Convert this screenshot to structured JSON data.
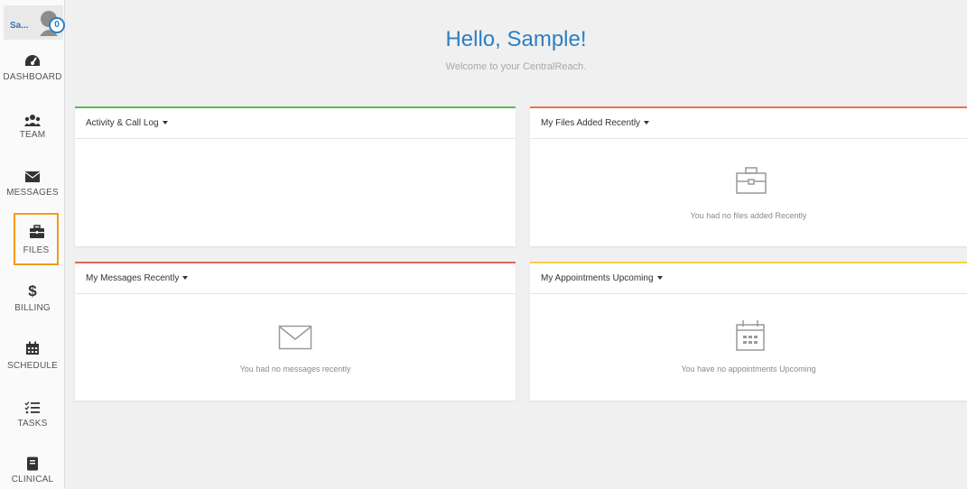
{
  "user": {
    "name": "Sa...",
    "notification_count": "0"
  },
  "nav": {
    "dashboard": "DASHBOARD",
    "team": "TEAM",
    "messages": "MESSAGES",
    "files": "FILES",
    "billing": "BILLING",
    "schedule": "SCHEDULE",
    "tasks": "TASKS",
    "clinical": "CLINICAL",
    "active": "FILES"
  },
  "header": {
    "title": "Hello, Sample!",
    "subtitle": "Welcome to your CentralReach."
  },
  "panels": {
    "activity": {
      "title": "Activity & Call Log",
      "accent": "#5cb85c",
      "empty": ""
    },
    "files": {
      "title": "My Files Added Recently",
      "accent": "#f0704a",
      "empty": "You had no files added Recently"
    },
    "messages": {
      "title": "My Messages Recently",
      "accent": "#e8625c",
      "empty": "You had no messages recently"
    },
    "appointments": {
      "title": "My Appointments Upcoming",
      "accent": "#f5d04a",
      "empty": "You have no appointments Upcoming"
    }
  },
  "colors": {
    "brand": "#2d7fc1",
    "active_nav_outline": "#f39a1e"
  },
  "icons": {
    "dashboard": "speedometer-icon",
    "team": "team-icon",
    "messages": "envelope-icon",
    "files": "briefcase-icon",
    "billing": "dollar-icon",
    "schedule": "calendar-icon",
    "tasks": "checklist-icon",
    "clinical": "book-icon"
  }
}
